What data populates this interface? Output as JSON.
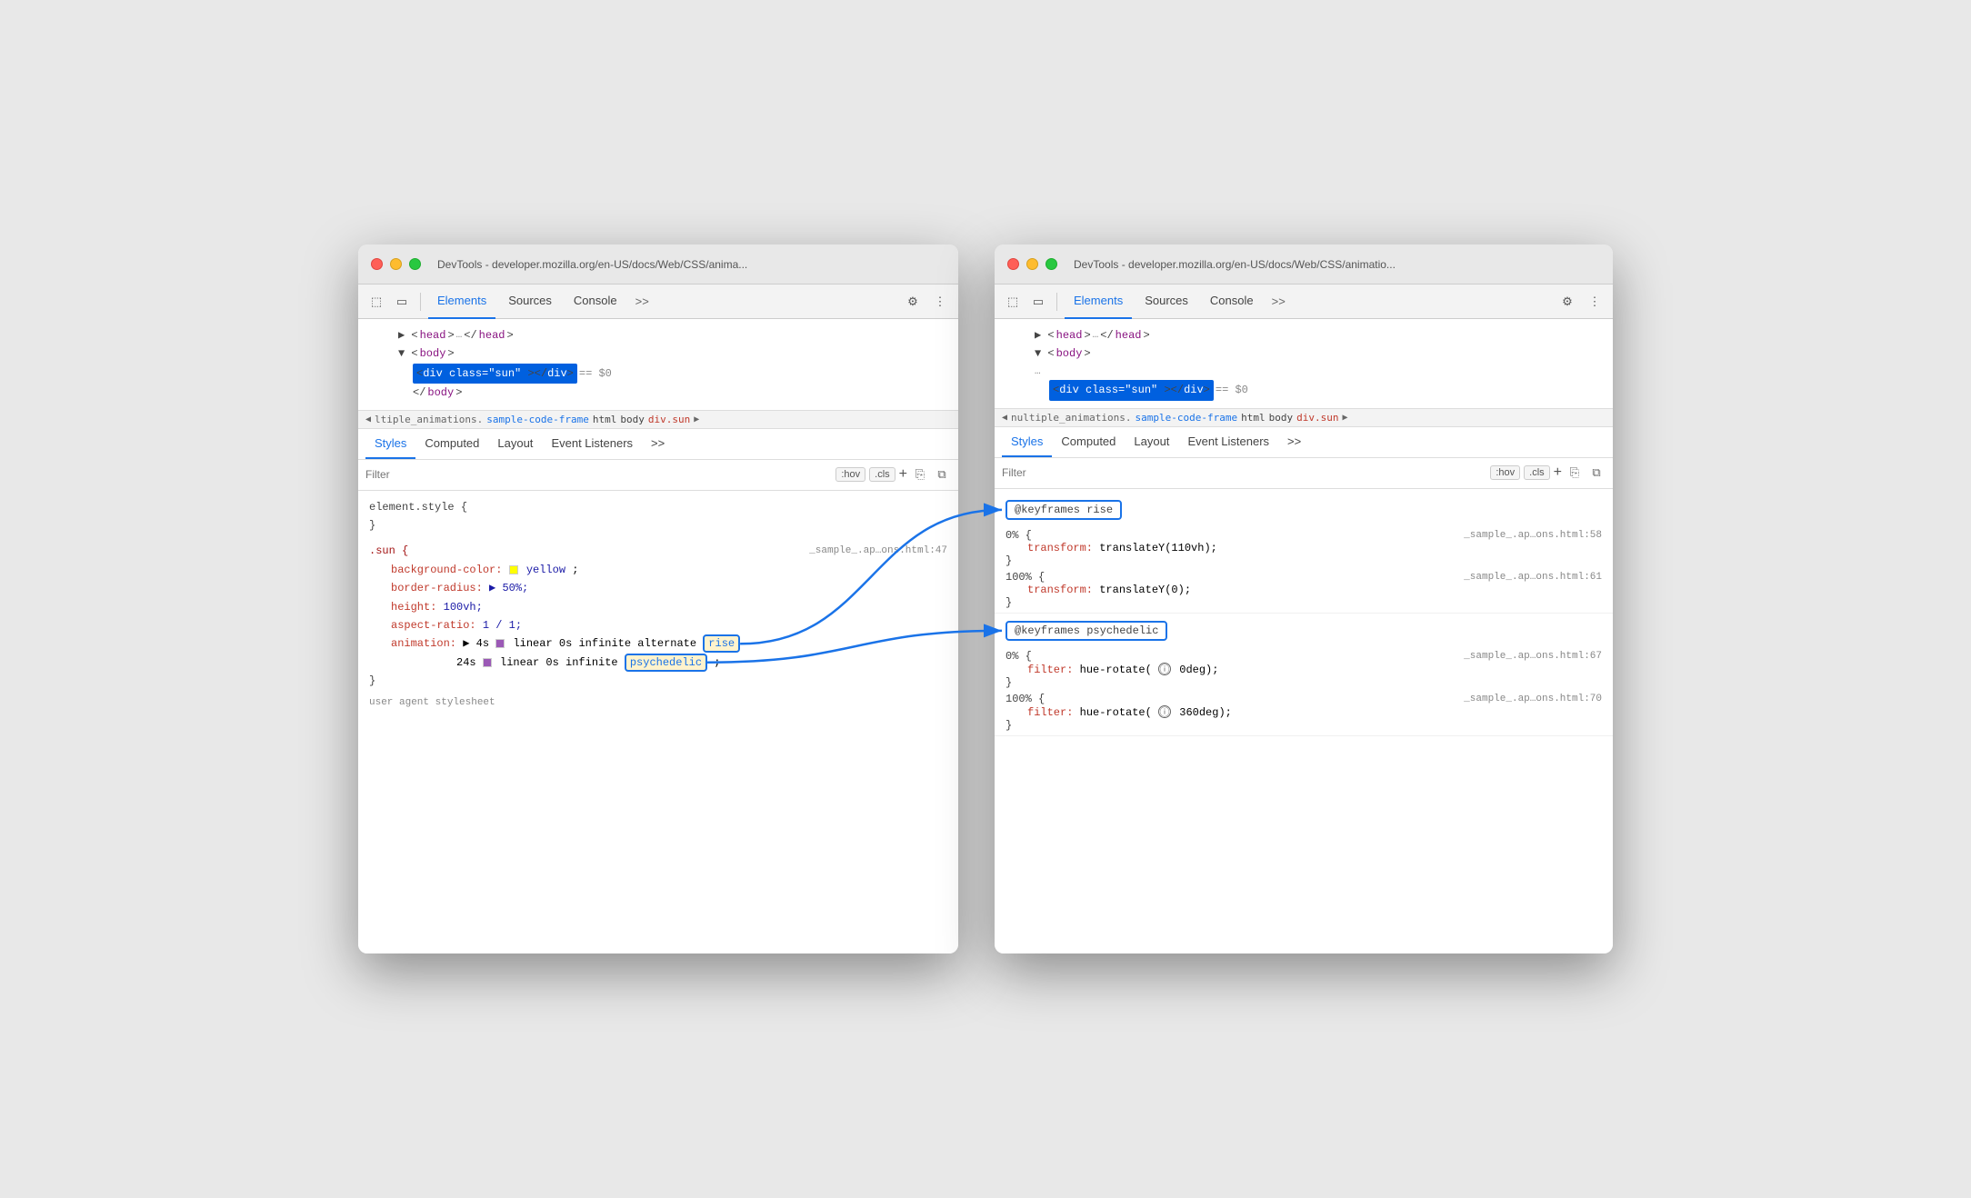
{
  "left_window": {
    "title": "DevTools - developer.mozilla.org/en-US/docs/Web/CSS/anima...",
    "traffic_lights": [
      "red",
      "yellow",
      "green"
    ],
    "toolbar": {
      "icons": [
        "cursor-icon",
        "device-icon"
      ],
      "tabs": [
        "Elements",
        "Sources",
        "Console"
      ],
      "more": ">>",
      "gear_label": "⚙",
      "menu_label": "⋮"
    },
    "dom": {
      "lines": [
        {
          "indent": 2,
          "content": "▶ <head> … </head>"
        },
        {
          "indent": 2,
          "content": "▼ <body>"
        },
        {
          "indent": 3,
          "content": "<div class=\"sun\"></div> == $0",
          "selected": true
        },
        {
          "indent": 3,
          "content": "</body>"
        }
      ]
    },
    "breadcrumb": {
      "arrow": "◀",
      "items": [
        "ltiple_animations.",
        "sample-code-frame",
        "html",
        "body",
        "div.sun"
      ],
      "arrow_right": "▶"
    },
    "styles_tabs": [
      "Styles",
      "Computed",
      "Layout",
      "Event Listeners",
      ">>"
    ],
    "filter": {
      "placeholder": "Filter",
      "hov": ":hov",
      "cls": ".cls",
      "plus": "+",
      "icons": [
        "copy-icon",
        "sidebar-icon"
      ]
    },
    "rules": [
      {
        "selector": "element.style {",
        "close": "}",
        "source": "",
        "props": []
      },
      {
        "selector": ".sun {",
        "source": "_sample_.ap…ons.html:47",
        "props": [
          {
            "name": "background-color:",
            "value": "yellow",
            "swatch": "yellow"
          },
          {
            "name": "border-radius:",
            "value": "▶ 50%;"
          },
          {
            "name": "height:",
            "value": "100vh;"
          },
          {
            "name": "aspect-ratio:",
            "value": "1 / 1;"
          },
          {
            "name": "animation:",
            "value": "▶ 4s ■ linear 0s infinite alternate rise"
          },
          {
            "name": "",
            "value": "24s ■ linear 0s infinite psychedelic;"
          }
        ],
        "close": "}"
      }
    ],
    "animation_highlights": {
      "rise": "rise",
      "psychedelic": "psychedelic"
    }
  },
  "right_window": {
    "title": "DevTools - developer.mozilla.org/en-US/docs/Web/CSS/animatio...",
    "traffic_lights": [
      "red",
      "yellow",
      "green"
    ],
    "toolbar": {
      "icons": [
        "cursor-icon",
        "device-icon"
      ],
      "tabs": [
        "Elements",
        "Sources",
        "Console"
      ],
      "more": ">>",
      "gear_label": "⚙",
      "menu_label": "⋮"
    },
    "dom": {
      "lines": [
        {
          "indent": 2,
          "content": "▶ <head> … </head>"
        },
        {
          "indent": 2,
          "content": "▼ <body>"
        },
        {
          "indent": 3,
          "content": "…",
          "dots": true
        },
        {
          "indent": 3,
          "content": "<div class=\"sun\"></div> == $0",
          "selected": true
        }
      ]
    },
    "breadcrumb": {
      "arrow": "◀",
      "items": [
        "nultiple_animations.",
        "sample-code-frame",
        "html",
        "body",
        "div.sun"
      ],
      "arrow_right": "▶"
    },
    "styles_tabs": [
      "Styles",
      "Computed",
      "Layout",
      "Event Listeners",
      ">>"
    ],
    "filter": {
      "placeholder": "Filter",
      "hov": ":hov",
      "cls": ".cls",
      "plus": "+",
      "icons": [
        "copy-icon",
        "sidebar-icon"
      ]
    },
    "keyframes": [
      {
        "name": "@keyframes rise",
        "blocks": [
          {
            "percent": "0% {",
            "source": "_sample_.ap…ons.html:58",
            "props": [
              {
                "name": "transform:",
                "value": "translateY(110vh);"
              }
            ],
            "close": "}"
          },
          {
            "percent": "100% {",
            "source": "_sample_.ap…ons.html:61",
            "props": [
              {
                "name": "transform:",
                "value": "translateY(0);"
              }
            ],
            "close": "}"
          }
        ]
      },
      {
        "name": "@keyframes psychedelic",
        "blocks": [
          {
            "percent": "0% {",
            "source": "_sample_.ap…ons.html:67",
            "props": [
              {
                "name": "filter:",
                "value": "hue-rotate(⓵0deg);"
              }
            ],
            "close": "}"
          },
          {
            "percent": "100% {",
            "source": "_sample_.ap…ons.html:70",
            "props": [
              {
                "name": "filter:",
                "value": "hue-rotate(⓵360deg);"
              }
            ],
            "close": "}"
          }
        ]
      }
    ]
  },
  "arrows": [
    {
      "from": "rise-highlight",
      "to": "rise-keyframe",
      "label": ""
    },
    {
      "from": "psychedelic-highlight",
      "to": "psychedelic-keyframe",
      "label": ""
    }
  ]
}
